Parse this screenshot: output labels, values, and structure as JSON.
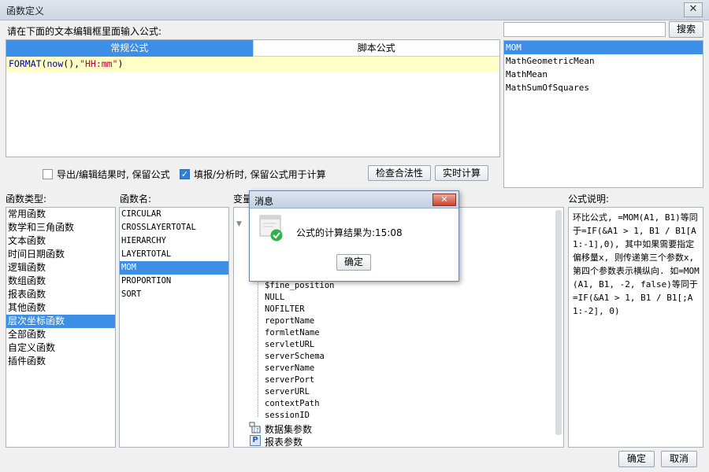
{
  "window": {
    "title": "函数定义",
    "close_glyph": "✕"
  },
  "editor": {
    "prompt": "请在下面的文本编辑框里面输入公式:",
    "tabs": [
      {
        "label": "常规公式",
        "active": true
      },
      {
        "label": "脚本公式",
        "active": false
      }
    ],
    "formula": {
      "fn": "FORMAT",
      "p1": "(",
      "inner": "now",
      "p2": "(),",
      "str": "\"HH:mm\"",
      "p3": ")"
    }
  },
  "search": {
    "value": "",
    "button_label": "搜索"
  },
  "match_list": [
    "MOM",
    "MathGeometricMean",
    "MathMean",
    "MathSumOfSquares"
  ],
  "options": {
    "keep_on_export": {
      "label": "导出/编辑结果时, 保留公式",
      "checked": false
    },
    "keep_on_fill": {
      "label": "填报/分析时, 保留公式用于计算",
      "checked": true
    },
    "check_label": "检查合法性",
    "realtime_label": "实时计算"
  },
  "panels": {
    "category_header": "函数类型:",
    "function_header": "函数名:",
    "variable_header": "变量",
    "description_header": "公式说明:"
  },
  "categories": [
    "常用函数",
    "数学和三角函数",
    "文本函数",
    "时间日期函数",
    "逻辑函数",
    "数组函数",
    "报表函数",
    "其他函数",
    "层次坐标函数",
    "全部函数",
    "自定义函数",
    "插件函数"
  ],
  "selected_category_index": 8,
  "functions": [
    "CIRCULAR",
    "CROSSLAYERTOTAL",
    "HIERARCHY",
    "LAYERTOTAL",
    "MOM",
    "PROPORTION",
    "SORT"
  ],
  "selected_function_index": 4,
  "variables": [
    "$fine_position",
    "NULL",
    "NOFILTER",
    "reportName",
    "formletName",
    "servletURL",
    "serverSchema",
    "serverName",
    "serverPort",
    "serverURL",
    "contextPath",
    "sessionID"
  ],
  "variable_groups": [
    "数据集参数",
    "报表参数"
  ],
  "description": "环比公式, =MOM(A1, B1)等同于=IF(&A1 > 1, B1 / B1[A1:-1],0), 其中如果需要指定偏移量x, 则传递第三个参数x, 第四个参数表示横纵向. 如=MOM(A1, B1, -2, false)等同于=IF(&A1 > 1, B1 / B1[;A1:-2], 0)",
  "footer": {
    "ok_label": "确定",
    "cancel_label": "取消"
  },
  "message_dialog": {
    "title": "消息",
    "text": "公式的计算结果为:15:08",
    "ok_label": "确定",
    "close_glyph": "✕"
  },
  "colors": {
    "accent": "#3c8ee6",
    "formula_bg": "#ffffc6",
    "success": "#2fb24a"
  }
}
